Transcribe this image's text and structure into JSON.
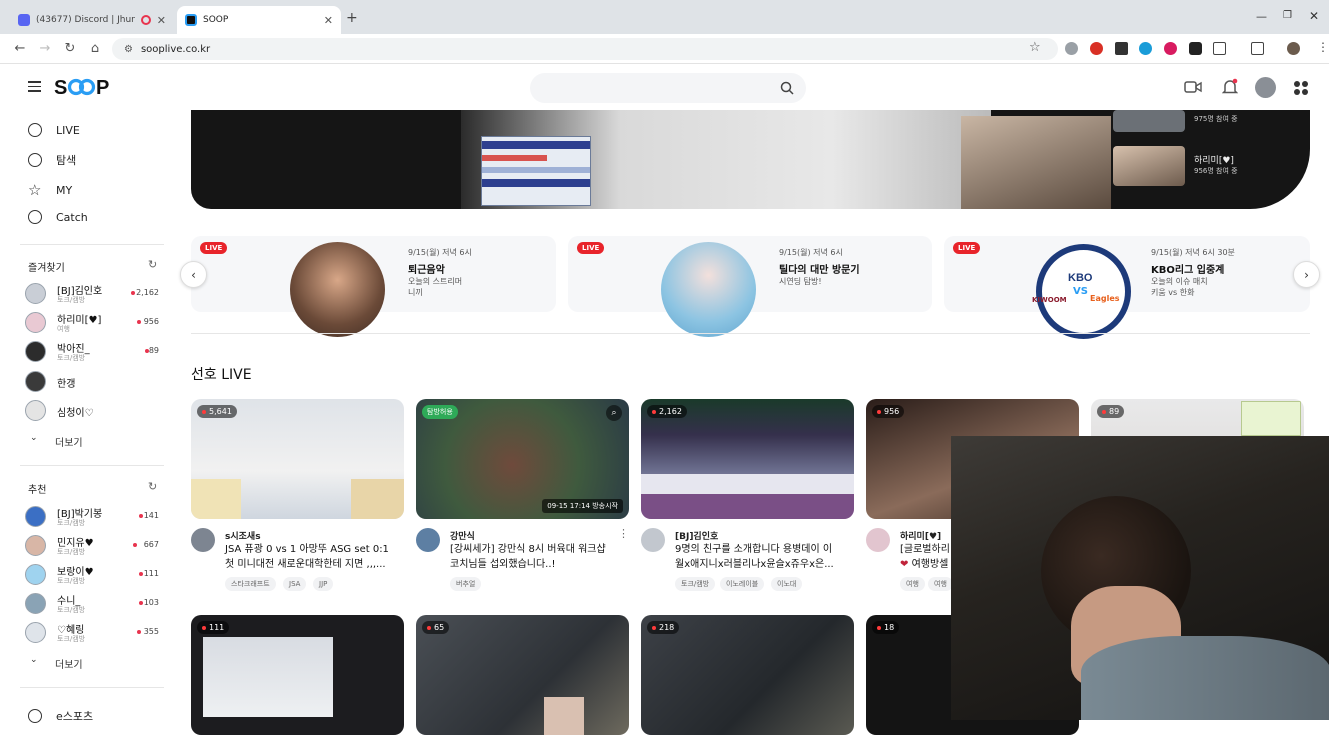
{
  "browser": {
    "tabs": [
      {
        "label": "(43677) Discord | Jhunter, R",
        "active": false
      },
      {
        "label": "SOOP",
        "active": true
      }
    ],
    "new_tab": "+",
    "url": "sooplive.co.kr"
  },
  "site": {
    "logo": "SOOP",
    "logo_color": "#2a9df4"
  },
  "sidebar": {
    "nav": [
      {
        "label": "LIVE",
        "icon": "live-icon"
      },
      {
        "label": "탐색",
        "icon": "compass-icon"
      },
      {
        "label": "MY",
        "icon": "star-icon"
      },
      {
        "label": "Catch",
        "icon": "catch-icon"
      }
    ],
    "favorites_title": "즐겨찾기",
    "favorites": [
      {
        "name": "[BJ]김인호",
        "cat": "토크/캠방",
        "count": "2,162"
      },
      {
        "name": "하리미[♥]",
        "cat": "여행",
        "count": "956"
      },
      {
        "name": "박아진_",
        "cat": "토크/캠방",
        "count": "89"
      },
      {
        "name": "한갱",
        "cat": "",
        "count": ""
      },
      {
        "name": "심청이♡",
        "cat": "",
        "count": ""
      }
    ],
    "more_label": "더보기",
    "recommend_title": "추천",
    "recommend": [
      {
        "name": "[BJ]박기봉",
        "cat": "토크/캠방",
        "count": "141"
      },
      {
        "name": "민지유♥",
        "cat": "토크/캠방",
        "count": "667"
      },
      {
        "name": "보랑이♥",
        "cat": "토크/캠방",
        "count": "111"
      },
      {
        "name": "수니_",
        "cat": "토크/캠방",
        "count": "103"
      },
      {
        "name": "♡혜링",
        "cat": "토크/캠방",
        "count": "355"
      }
    ],
    "more_label2": "더보기",
    "esports_label": "e스포츠"
  },
  "hero": {
    "side_items": [
      {
        "name": "",
        "viewers": "975명 참여 중"
      },
      {
        "name": "하리미[♥]",
        "viewers": "956명 참여 중"
      }
    ]
  },
  "promos": [
    {
      "badge": "LIVE",
      "date": "9/15(월) 저녁 6시",
      "title": "퇴근음악",
      "sub1": "오늘의 스트리머",
      "sub2": "니끼"
    },
    {
      "badge": "LIVE",
      "date": "9/15(월) 저녁 6시",
      "title": "틸다의 대만 방문기",
      "sub1": "시연딩 탐방!",
      "sub2": ""
    },
    {
      "badge": "LIVE",
      "date": "9/15(월) 저녁 6시 30분",
      "title": "KBO리그 입중계",
      "sub1": "오늘의 이슈 매치",
      "sub2": "키움 vs 한화"
    }
  ],
  "kbo_logo": {
    "left": "KIWOOM",
    "mid": "KBO",
    "vs": "VS",
    "right": "Eagles"
  },
  "section_title": "선호 LIVE",
  "cards": [
    {
      "viewers": "5,641",
      "name": "s시조새s",
      "title1": "JSA 퓨광 0 vs 1 아망뚜 ASG set 0:1",
      "title2": "첫 미니대전 새로운대학한테 지면 ,,,...",
      "tags": [
        "스타크래프트",
        "JSA",
        "JJP"
      ]
    },
    {
      "viewers": "",
      "badge": "탐방허용",
      "timestamp": "09-15 17:14 방송시작",
      "name": "강만식",
      "title1": "[강씨세가] 강만식 8시 버육대 워크샵",
      "title2": "코치님들 섭외했습니다..!",
      "tags": [
        "버추얼"
      ]
    },
    {
      "viewers": "2,162",
      "name": "[BJ]김인호",
      "title1": "9명의 친구를 소개합니다 용병데이 이",
      "title2": "월x애지니x러블리나x윤슬x쥬우x은...",
      "tags": [
        "토크/캠방",
        "이노레이블",
        "이노대"
      ]
    },
    {
      "viewers": "956",
      "name": "하리미[♥]",
      "title1": "[글로벌하리미",
      "title2": "여행방셀",
      "tags": [
        "여행",
        "여행"
      ]
    },
    {
      "viewers": "89",
      "name": "",
      "title1": "",
      "title2": "",
      "tags": []
    }
  ],
  "cards_row2": [
    {
      "viewers": "111"
    },
    {
      "viewers": "65"
    },
    {
      "viewers": "218"
    },
    {
      "viewers": "18"
    }
  ]
}
